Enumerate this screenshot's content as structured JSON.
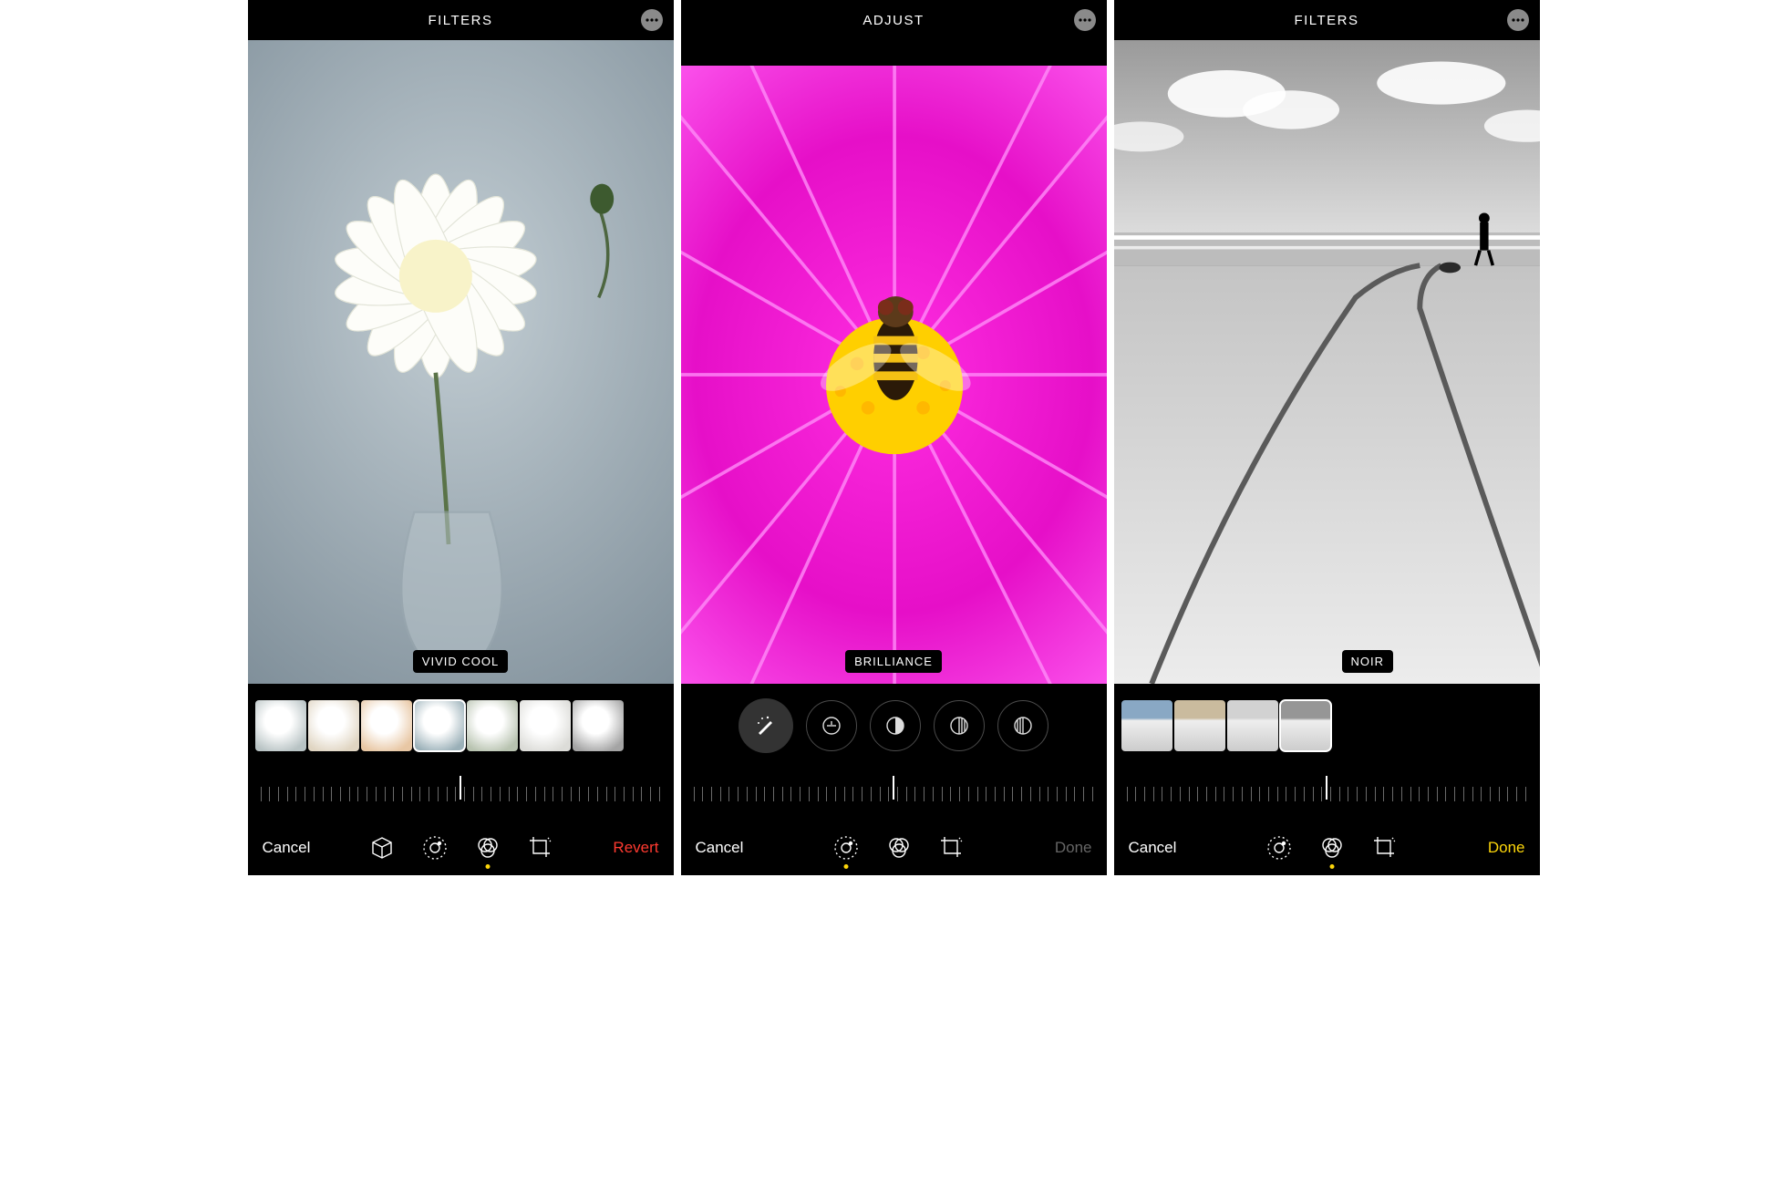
{
  "screens": [
    {
      "header": {
        "title": "FILTERS"
      },
      "badge": "VIVID COOL",
      "bottom": {
        "left": "Cancel",
        "right": "Revert",
        "rightClass": "revert",
        "tools": [
          "cube",
          "adjust",
          "filters",
          "crop"
        ],
        "activeTool": "filters"
      },
      "thumbs": {
        "selectedIndex": 3,
        "count": 7,
        "tints": [
          "#b8c3c4",
          "#e0d5c2",
          "#e8c7a4",
          "#9ab0b8",
          "#b8c3b0",
          "#dcdcd8",
          "#a4a4a4"
        ]
      }
    },
    {
      "header": {
        "title": "ADJUST"
      },
      "badge": "BRILLIANCE",
      "bottom": {
        "left": "Cancel",
        "right": "Done",
        "rightClass": "done-gray",
        "tools": [
          "adjust",
          "filters",
          "crop"
        ],
        "activeTool": "adjust"
      },
      "adjustments": [
        "auto",
        "exposure",
        "brilliance",
        "highlights",
        "shadows"
      ]
    },
    {
      "header": {
        "title": "FILTERS"
      },
      "badge": "NOIR",
      "bottom": {
        "left": "Cancel",
        "right": "Done",
        "rightClass": "done-yellow",
        "tools": [
          "adjust",
          "filters",
          "crop"
        ],
        "activeTool": "filters"
      },
      "thumbs": {
        "selectedIndex": 3,
        "count": 4,
        "tints": [
          "#89a8c4",
          "#cabb9e",
          "#d2d2d2",
          "#969696"
        ]
      }
    }
  ]
}
